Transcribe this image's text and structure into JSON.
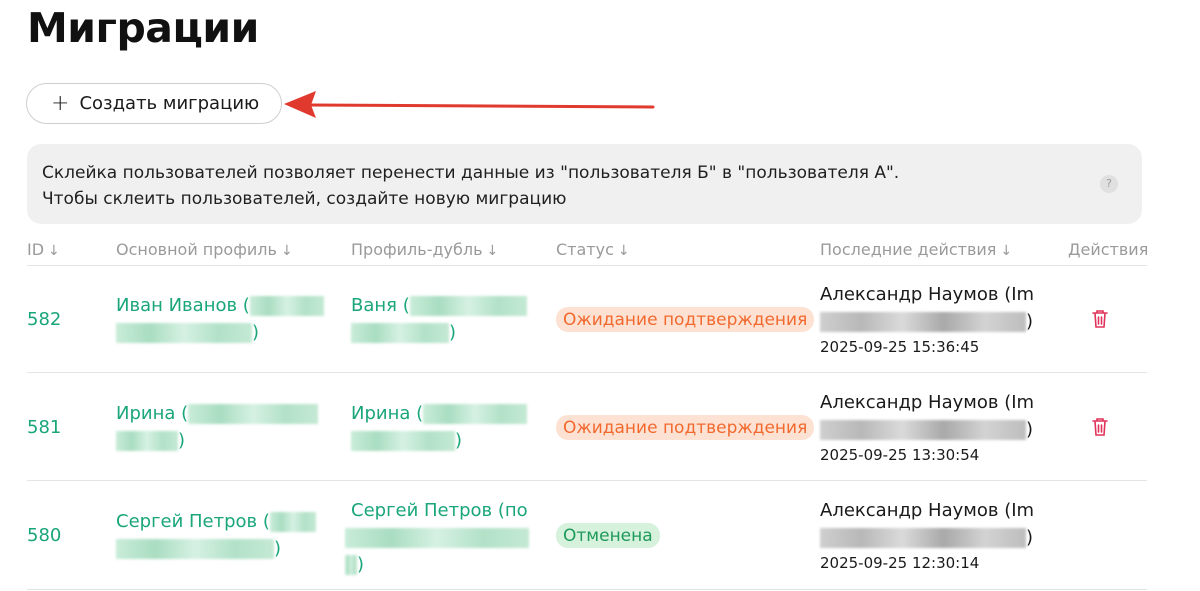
{
  "page": {
    "title": "Миграции"
  },
  "toolbar": {
    "create_icon": "+",
    "create_label": "Создать миграцию"
  },
  "info": {
    "line1": "Склейка пользователей позволяет перенести данные из \"пользователя Б\" в \"пользователя А\".",
    "line2": "Чтобы склеить пользователей, создайте новую миграцию",
    "help": "?"
  },
  "columns": {
    "id": "ID",
    "main": "Основной профиль",
    "dup": "Профиль-дубль",
    "status": "Статус",
    "last": "Последние действия",
    "actions": "Действия",
    "sort_icon": "↓"
  },
  "rows": [
    {
      "id": "582",
      "main_a": "Иван Иванов (",
      "main_b": ")",
      "dup_a": "Ваня (",
      "dup_b": ")",
      "status": "Ожидание подтверждения",
      "actor_a": "Александр Наумов (Im",
      "actor_b": ")",
      "time": "2025-09-25 15:36:45"
    },
    {
      "id": "581",
      "main_a": "Ирина (",
      "main_b": ")",
      "dup_a": "Ирина (",
      "dup_b": ")",
      "status": "Ожидание подтверждения",
      "actor_a": "Александр Наумов (Im",
      "actor_b": ")",
      "time": "2025-09-25 13:30:54"
    },
    {
      "id": "580",
      "main_a": "Сергей Петров (",
      "main_b": ")",
      "dup_a": "Сергей Петров (по",
      "dup_b": ")",
      "status": "Отменена",
      "actor_a": "Александр Наумов (Im",
      "actor_b": ")",
      "time": "2025-09-25 12:30:14"
    }
  ],
  "colors": {
    "accent": "#1aa67a",
    "pending": "#f2692e",
    "cancelled": "#1e9a5b",
    "delete": "#e0325a",
    "annotation_arrow": "#e03a2f"
  }
}
